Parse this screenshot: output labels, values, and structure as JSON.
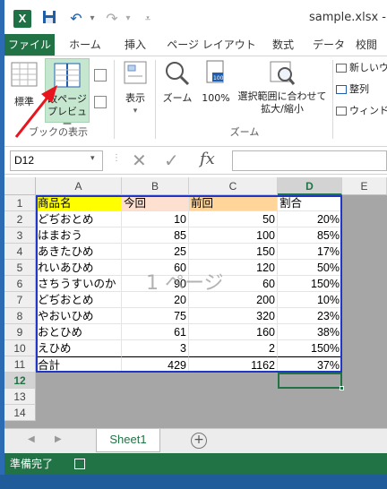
{
  "window": {
    "title": "sample.xlsx - E"
  },
  "ribbon_tabs": [
    "ファイル",
    "ホーム",
    "挿入",
    "ページ レイアウト",
    "数式",
    "データ",
    "校閲"
  ],
  "ribbon": {
    "workbook_views": {
      "normal": "標準",
      "page_break_preview_line1": "改ページ",
      "page_break_preview_line2": "プレビュー",
      "group_label": "ブックの表示"
    },
    "show": {
      "label": "表示"
    },
    "zoom": {
      "zoom": "ズーム",
      "hundred": "100%",
      "selection_line1": "選択範囲に合わせて",
      "selection_line2": "拡大/縮小",
      "group_label": "ズーム"
    },
    "window": {
      "new_window": "新しいウ",
      "arrange": "整列",
      "freeze": "ウィンドウ"
    }
  },
  "formula_bar": {
    "name_box": "D12",
    "fx": "fx"
  },
  "columns": [
    "A",
    "B",
    "C",
    "D",
    "E"
  ],
  "rows": [
    "1",
    "2",
    "3",
    "4",
    "5",
    "6",
    "7",
    "8",
    "9",
    "10",
    "11",
    "12",
    "13",
    "14"
  ],
  "table": {
    "header": [
      "商品名",
      "今回",
      "前回",
      "割合"
    ],
    "data": [
      [
        "どぢおとめ",
        "10",
        "50",
        "20%"
      ],
      [
        "はまおう",
        "85",
        "100",
        "85%"
      ],
      [
        "あきたひめ",
        "25",
        "150",
        "17%"
      ],
      [
        "れいあひめ",
        "60",
        "120",
        "50%"
      ],
      [
        "さちうすいのか",
        "90",
        "60",
        "150%"
      ],
      [
        "どぢおとめ",
        "20",
        "200",
        "10%"
      ],
      [
        "やおいひめ",
        "75",
        "320",
        "23%"
      ],
      [
        "おとひめ",
        "61",
        "160",
        "38%"
      ],
      [
        "えひめ",
        "3",
        "2",
        "150%"
      ]
    ],
    "total": [
      "合計",
      "429",
      "1162",
      "37%"
    ]
  },
  "watermark": "1 ページ",
  "sheet_tabs": {
    "active": "Sheet1"
  },
  "status": {
    "ready": "準備完了"
  },
  "colors": {
    "excel_green": "#217346",
    "header_yellow": "#ffff00",
    "header_peach": "#fde0d0",
    "header_orange": "#ffd59a",
    "print_border": "#1f36c7",
    "annotation_arrow": "#e8141e"
  }
}
